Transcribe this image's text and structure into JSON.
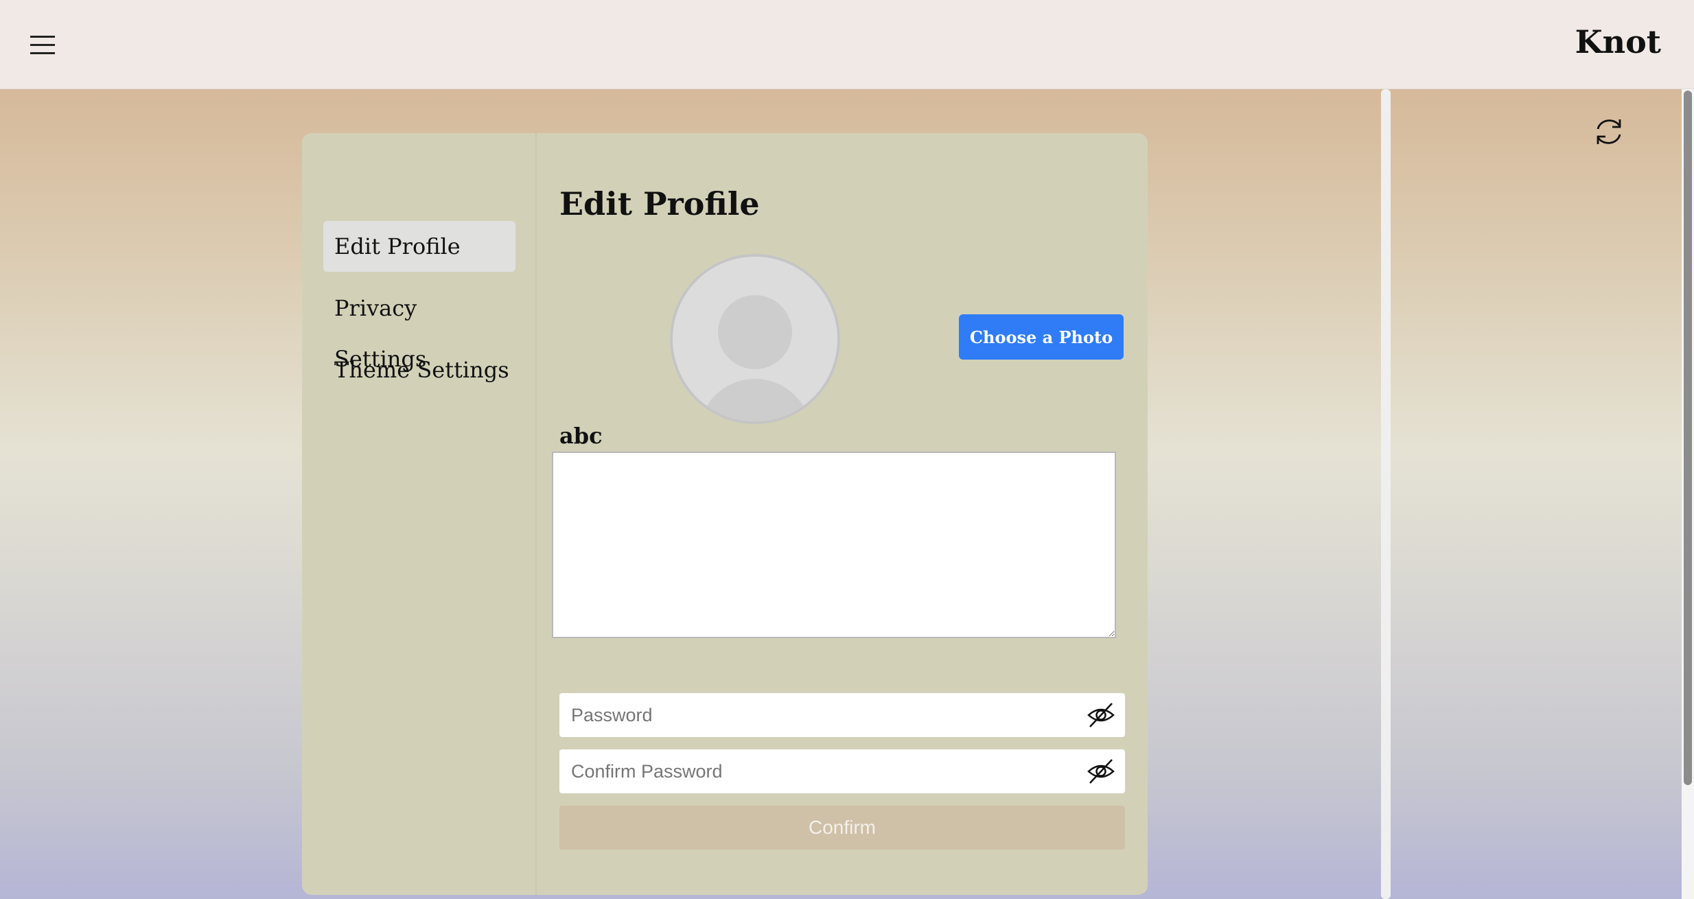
{
  "app": {
    "brand": "Knot"
  },
  "icons": {
    "menu": "hamburger-icon",
    "refresh": "refresh-icon",
    "password_toggle": "eye-slash-icon"
  },
  "sidebar": {
    "items": [
      {
        "label": "Edit Profile",
        "active": true
      },
      {
        "label": "Privacy Settings",
        "active": false
      },
      {
        "label": "Theme Settings",
        "active": false
      }
    ]
  },
  "main": {
    "title": "Edit Profile",
    "choose_photo_label": "Choose a Photo",
    "username": "abc",
    "bio_value": "",
    "password_placeholder": "Password",
    "confirm_password_placeholder": "Confirm Password",
    "confirm_label": "Confirm"
  },
  "colors": {
    "topbar": "#f1e9e6",
    "card": "#d2d1b8",
    "accent_button": "#2f7cf6",
    "confirm_button": "#cfc0a8"
  }
}
